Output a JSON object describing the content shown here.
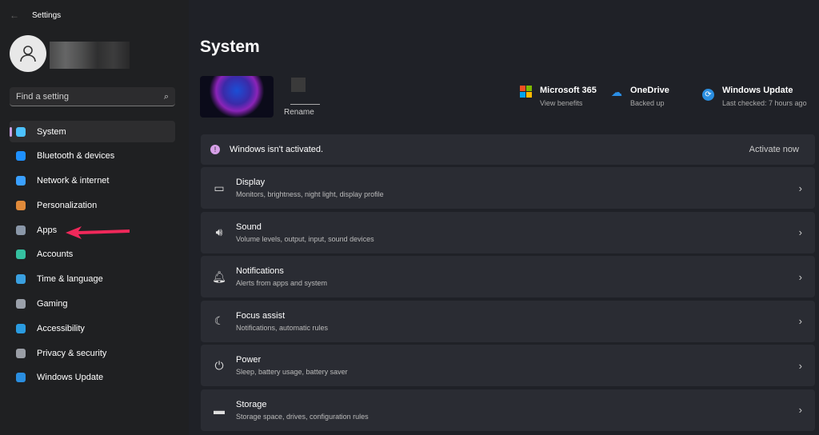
{
  "window": {
    "title": "Settings"
  },
  "sidebar": {
    "search_placeholder": "Find a setting",
    "items": [
      {
        "label": "System",
        "color": "#4cc2ff"
      },
      {
        "label": "Bluetooth & devices",
        "color": "#1e90ff"
      },
      {
        "label": "Network & internet",
        "color": "#3aa0ff"
      },
      {
        "label": "Personalization",
        "color": "#e08a3a"
      },
      {
        "label": "Apps",
        "color": "#8a97a8"
      },
      {
        "label": "Accounts",
        "color": "#35c0a0"
      },
      {
        "label": "Time & language",
        "color": "#3aa0e0"
      },
      {
        "label": "Gaming",
        "color": "#9aa0aa"
      },
      {
        "label": "Accessibility",
        "color": "#2a9be0"
      },
      {
        "label": "Privacy & security",
        "color": "#9a9ea6"
      },
      {
        "label": "Windows Update",
        "color": "#2a8ee0"
      }
    ]
  },
  "main": {
    "title": "System",
    "rename": "Rename",
    "quick": [
      {
        "title": "Microsoft 365",
        "sub": "View benefits"
      },
      {
        "title": "OneDrive",
        "sub": "Backed up"
      },
      {
        "title": "Windows Update",
        "sub": "Last checked: 7 hours ago"
      }
    ],
    "activation": {
      "text": "Windows isn't activated.",
      "action": "Activate now"
    },
    "rows": [
      {
        "title": "Display",
        "sub": "Monitors, brightness, night light, display profile",
        "icon": "▭"
      },
      {
        "title": "Sound",
        "sub": "Volume levels, output, input, sound devices",
        "icon": "🔊︎"
      },
      {
        "title": "Notifications",
        "sub": "Alerts from apps and system",
        "icon": "🔔︎"
      },
      {
        "title": "Focus assist",
        "sub": "Notifications, automatic rules",
        "icon": "☾"
      },
      {
        "title": "Power",
        "sub": "Sleep, battery usage, battery saver",
        "icon": "⏻"
      },
      {
        "title": "Storage",
        "sub": "Storage space, drives, configuration rules",
        "icon": "▬"
      }
    ]
  }
}
